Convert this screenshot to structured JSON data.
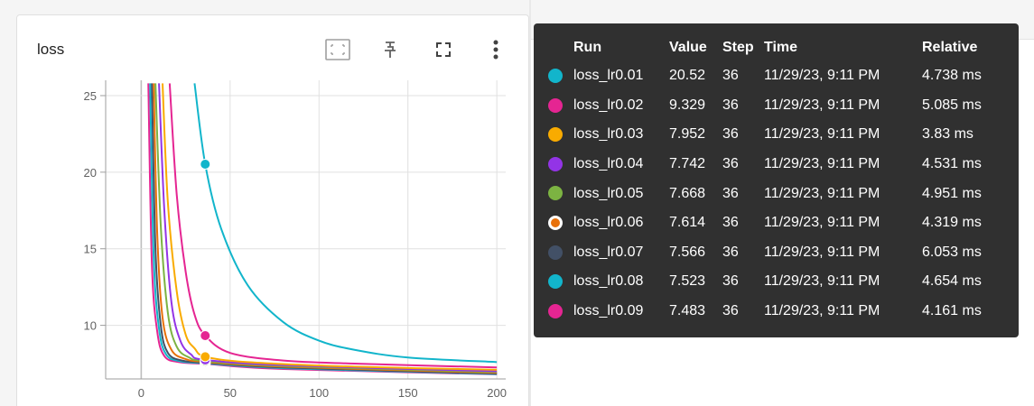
{
  "card": {
    "title": "loss",
    "toolbar": [
      {
        "icon": "fit-domain-icon"
      },
      {
        "icon": "pin-icon"
      },
      {
        "icon": "fullscreen-icon"
      },
      {
        "icon": "more-vert-icon"
      }
    ]
  },
  "tooltip": {
    "headers": {
      "run": "Run",
      "value": "Value",
      "step": "Step",
      "time": "Time",
      "relative": "Relative"
    },
    "rows": [
      {
        "color": "#12b5cb",
        "run": "loss_lr0.01",
        "value": "20.52",
        "step": "36",
        "time": "11/29/23, 9:11 PM",
        "relative": "4.738 ms"
      },
      {
        "color": "#e52592",
        "run": "loss_lr0.02",
        "value": "9.329",
        "step": "36",
        "time": "11/29/23, 9:11 PM",
        "relative": "5.085 ms"
      },
      {
        "color": "#f9ab00",
        "run": "loss_lr0.03",
        "value": "7.952",
        "step": "36",
        "time": "11/29/23, 9:11 PM",
        "relative": "3.83 ms"
      },
      {
        "color": "#9334e6",
        "run": "loss_lr0.04",
        "value": "7.742",
        "step": "36",
        "time": "11/29/23, 9:11 PM",
        "relative": "4.531 ms"
      },
      {
        "color": "#7cb342",
        "run": "loss_lr0.05",
        "value": "7.668",
        "step": "36",
        "time": "11/29/23, 9:11 PM",
        "relative": "4.951 ms"
      },
      {
        "color": "#e8710a",
        "run": "loss_lr0.06",
        "value": "7.614",
        "step": "36",
        "time": "11/29/23, 9:11 PM",
        "relative": "4.319 ms"
      },
      {
        "color": "#425066",
        "run": "loss_lr0.07",
        "value": "7.566",
        "step": "36",
        "time": "11/29/23, 9:11 PM",
        "relative": "6.053 ms"
      },
      {
        "color": "#12b5cb",
        "run": "loss_lr0.08",
        "value": "7.523",
        "step": "36",
        "time": "11/29/23, 9:11 PM",
        "relative": "4.654 ms"
      },
      {
        "color": "#e52592",
        "run": "loss_lr0.09",
        "value": "7.483",
        "step": "36",
        "time": "11/29/23, 9:11 PM",
        "relative": "4.161 ms"
      }
    ]
  },
  "chart_data": {
    "type": "line",
    "title": "loss",
    "xlabel": "",
    "ylabel": "",
    "xlim": [
      -20,
      205
    ],
    "ylim": [
      6.5,
      26
    ],
    "x_ticks": [
      0,
      50,
      100,
      150,
      200
    ],
    "y_ticks": [
      10,
      15,
      20,
      25
    ],
    "grid": true,
    "legend": "none",
    "hover_step": 36,
    "series": [
      {
        "color": "#12b5cb",
        "values": [
          [
            30,
            25.8
          ],
          [
            36,
            20.52
          ],
          [
            45,
            16.3
          ],
          [
            60,
            12.6
          ],
          [
            80,
            10.2
          ],
          [
            100,
            9.0
          ],
          [
            120,
            8.4
          ],
          [
            150,
            7.9
          ],
          [
            200,
            7.6
          ]
        ]
      },
      {
        "color": "#e52592",
        "values": [
          [
            16,
            25.8
          ],
          [
            20,
            18.5
          ],
          [
            25,
            13.5
          ],
          [
            30,
            10.7
          ],
          [
            36,
            9.329
          ],
          [
            50,
            8.2
          ],
          [
            80,
            7.7
          ],
          [
            120,
            7.5
          ],
          [
            200,
            7.25
          ]
        ]
      },
      {
        "color": "#f9ab00",
        "values": [
          [
            12,
            25.8
          ],
          [
            15,
            18.0
          ],
          [
            20,
            12.2
          ],
          [
            25,
            9.4
          ],
          [
            30,
            8.5
          ],
          [
            36,
            7.952
          ],
          [
            60,
            7.6
          ],
          [
            120,
            7.3
          ],
          [
            200,
            7.1
          ]
        ]
      },
      {
        "color": "#9334e6",
        "values": [
          [
            10,
            25.8
          ],
          [
            13,
            17.5
          ],
          [
            17,
            11.5
          ],
          [
            22,
            9.0
          ],
          [
            28,
            8.1
          ],
          [
            36,
            7.742
          ],
          [
            80,
            7.4
          ],
          [
            200,
            7.0
          ]
        ]
      },
      {
        "color": "#7cb342",
        "values": [
          [
            8,
            25.8
          ],
          [
            11,
            16.5
          ],
          [
            15,
            10.8
          ],
          [
            20,
            8.6
          ],
          [
            27,
            7.9
          ],
          [
            36,
            7.668
          ],
          [
            80,
            7.35
          ],
          [
            200,
            6.95
          ]
        ]
      },
      {
        "color": "#e8710a",
        "values": [
          [
            7,
            25.8
          ],
          [
            9,
            16.0
          ],
          [
            12,
            10.5
          ],
          [
            17,
            8.4
          ],
          [
            25,
            7.8
          ],
          [
            36,
            7.614
          ],
          [
            80,
            7.3
          ],
          [
            200,
            6.9
          ]
        ]
      },
      {
        "color": "#425066",
        "values": [
          [
            6,
            25.8
          ],
          [
            8,
            15.0
          ],
          [
            11,
            10.0
          ],
          [
            15,
            8.2
          ],
          [
            23,
            7.7
          ],
          [
            36,
            7.566
          ],
          [
            80,
            7.25
          ],
          [
            200,
            6.85
          ]
        ]
      },
      {
        "color": "#12b5cb",
        "values": [
          [
            5,
            25.8
          ],
          [
            7,
            14.5
          ],
          [
            10,
            9.8
          ],
          [
            14,
            8.1
          ],
          [
            22,
            7.65
          ],
          [
            36,
            7.523
          ],
          [
            80,
            7.2
          ],
          [
            200,
            6.82
          ]
        ]
      },
      {
        "color": "#e52592",
        "values": [
          [
            4,
            25.8
          ],
          [
            6,
            14.0
          ],
          [
            9,
            9.6
          ],
          [
            13,
            8.0
          ],
          [
            21,
            7.6
          ],
          [
            36,
            7.483
          ],
          [
            80,
            7.15
          ],
          [
            200,
            6.8
          ]
        ]
      }
    ]
  }
}
